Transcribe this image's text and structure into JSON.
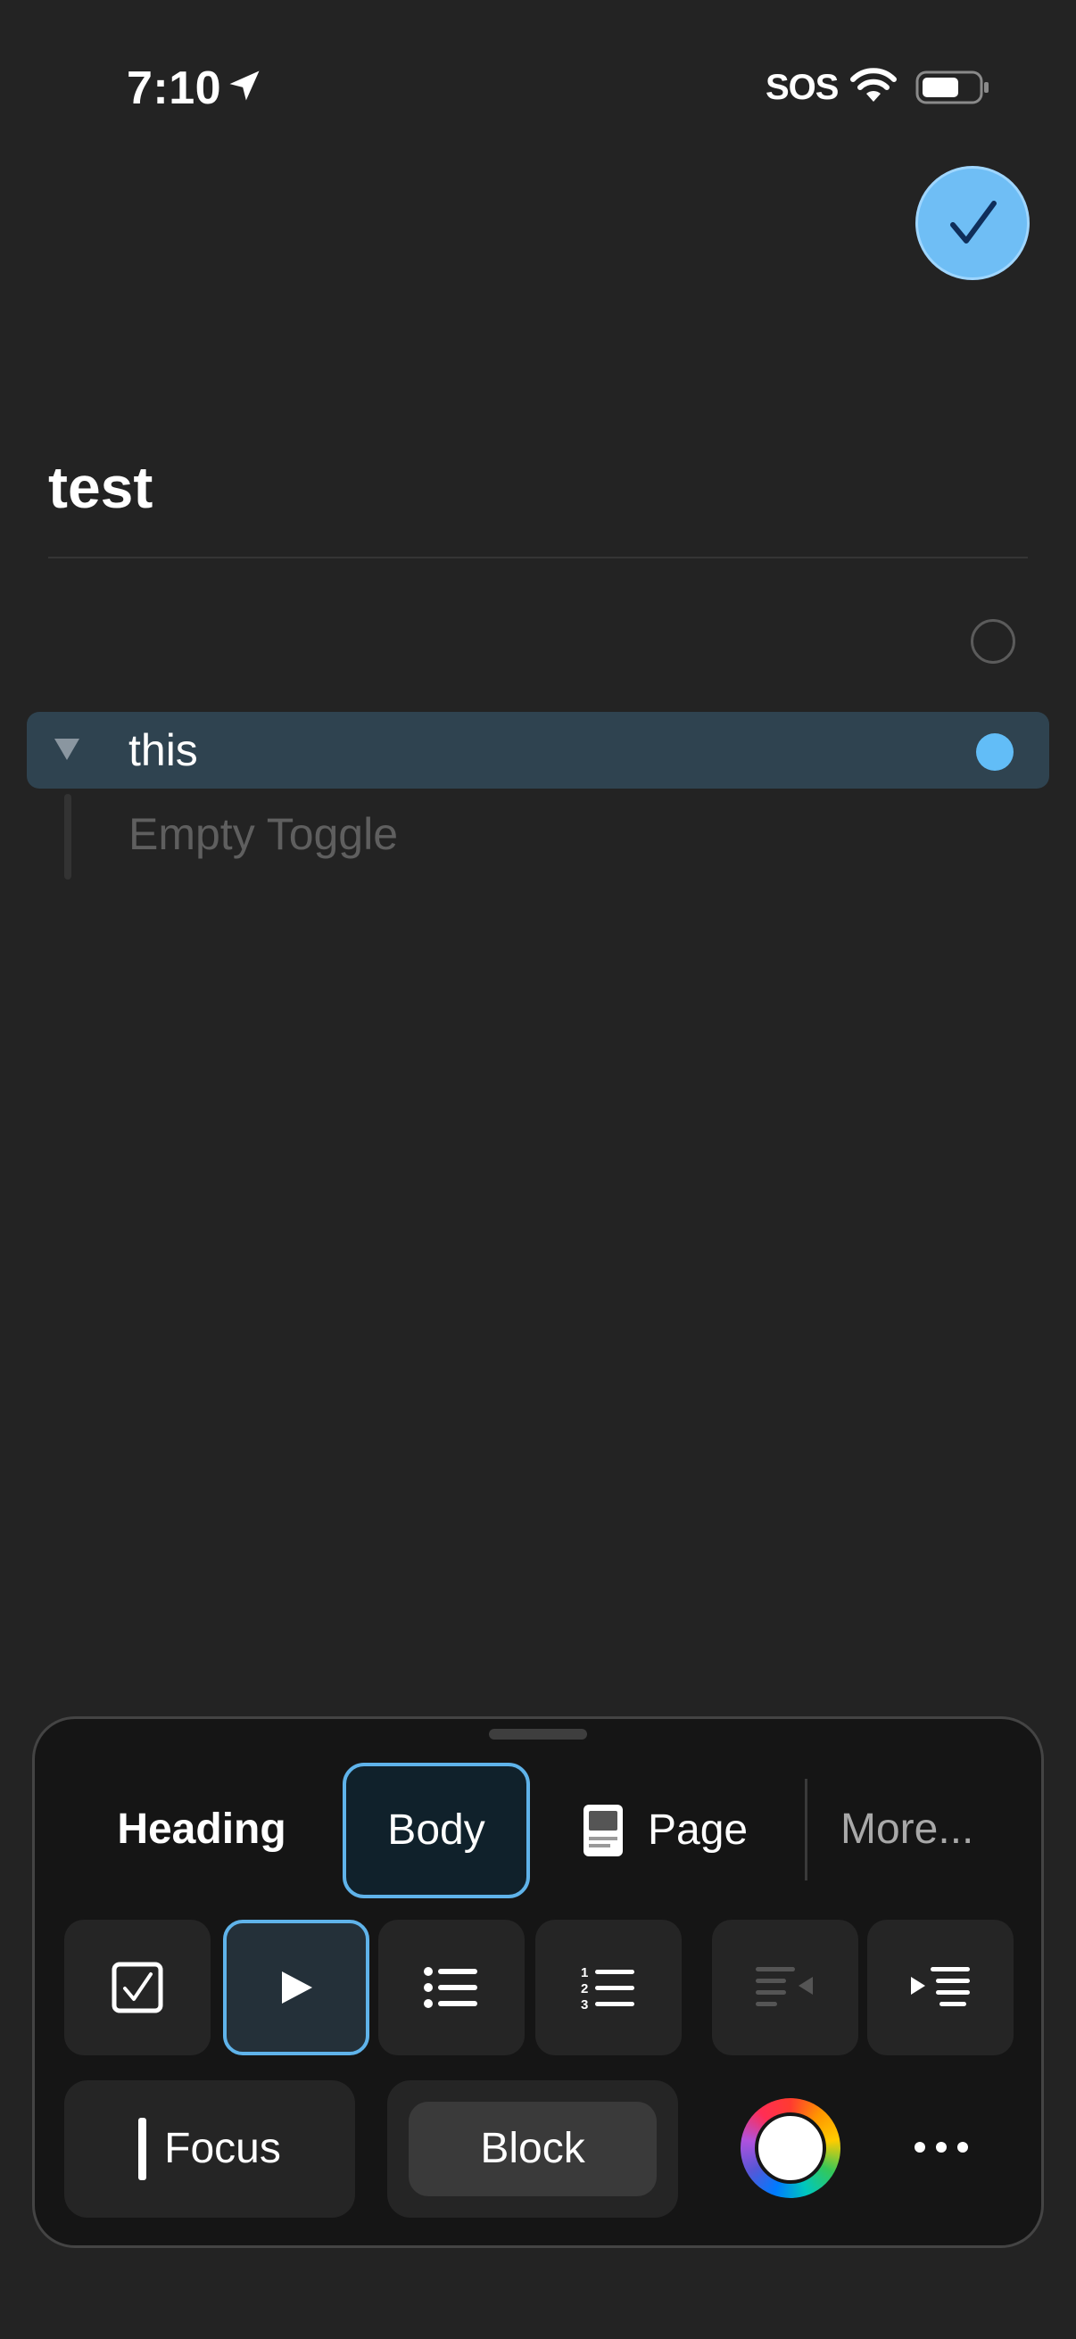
{
  "status_bar": {
    "time": "7:10",
    "carrier": "SOS"
  },
  "note": {
    "title": "test"
  },
  "blocks": [
    {
      "type": "toggle",
      "text": "this",
      "child_placeholder": "Empty Toggle"
    }
  ],
  "toolbar": {
    "styles": {
      "heading": "Heading",
      "body": "Body",
      "page": "Page",
      "more": "More..."
    },
    "bottom": {
      "focus": "Focus",
      "block": "Block"
    }
  },
  "colors": {
    "accent": "#5fb3ea",
    "background": "#232323",
    "selected_row": "#2f4350"
  }
}
